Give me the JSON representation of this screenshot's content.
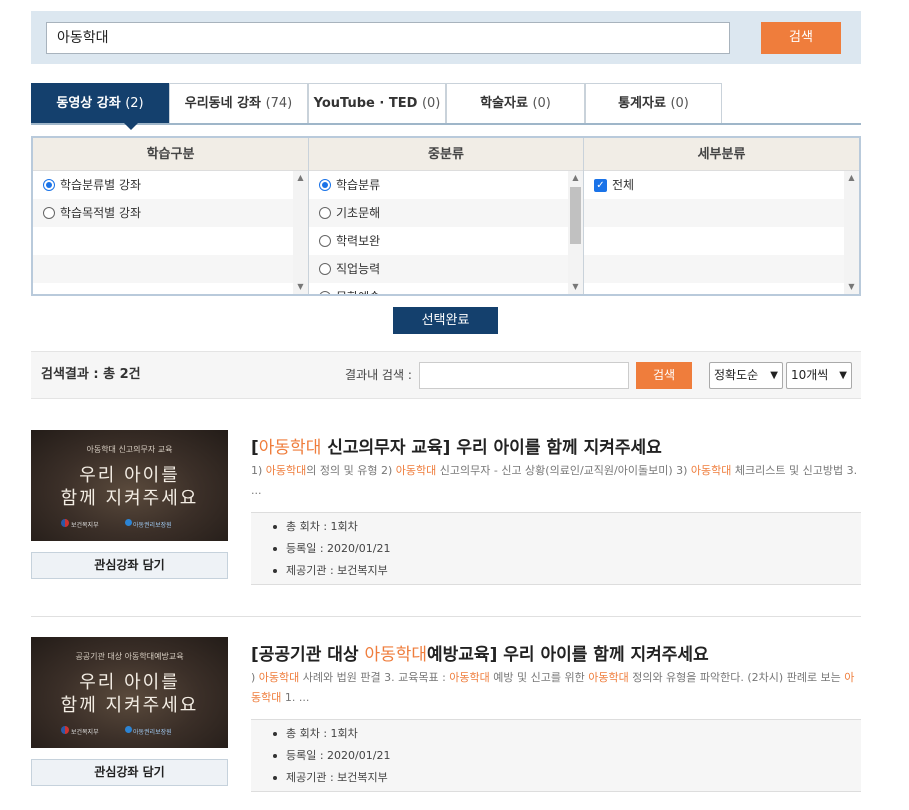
{
  "search": {
    "value": "아동학대",
    "button": "검색"
  },
  "tabs": [
    {
      "label": "동영상 강좌",
      "count": "(2)",
      "active": true
    },
    {
      "label": "우리동네 강좌",
      "count": "(74)"
    },
    {
      "label": "YouTube · TED",
      "count": "(0)"
    },
    {
      "label": "학술자료",
      "count": "(0)"
    },
    {
      "label": "통계자료",
      "count": "(0)"
    }
  ],
  "categories": {
    "col1": {
      "header": "학습구분",
      "items": [
        "학습분류별 강좌",
        "학습목적별 강좌"
      ]
    },
    "col2": {
      "header": "중분류",
      "items": [
        "학습분류",
        "기초문해",
        "학력보완",
        "직업능력",
        "문화예술"
      ]
    },
    "col3": {
      "header": "세부분류",
      "items": [
        "전체"
      ]
    }
  },
  "select_done": "선택완료",
  "result_bar": {
    "count_text": "검색결과 : 총 2건",
    "in_search_label": "결과내 검색 :",
    "in_search_button": "검색",
    "sort_value": "정확도순",
    "per_page_value": "10개씩"
  },
  "items": [
    {
      "thumb_small": "아동학대 신고의무자 교육",
      "thumb_line1": "우리 아이를",
      "thumb_line2": "함께 지켜주세요",
      "thumb_logo1": "보건복지부",
      "thumb_logo2": "아동권리보장원",
      "title_pre": "[",
      "title_hl": "아동학대",
      "title_post": " 신고의무자 교육] 우리 아이를 함께 지켜주세요",
      "desc_parts": [
        "1) ",
        "아동학대",
        "의 정의 및 유형 2) ",
        "아동학대",
        " 신고의무자 - 신고 상황(의료인/교직원/아이돌보미) 3) ",
        "아동학대",
        " 체크리스트 및 신고방법 3. ..."
      ],
      "meta": [
        "총 회차 : 1회차",
        "등록일 : 2020/01/21",
        "제공기관 : 보건복지부"
      ],
      "wish": "관심강좌 담기"
    },
    {
      "thumb_small": "공공기관 대상 아동학대예방교육",
      "thumb_line1": "우리 아이를",
      "thumb_line2": "함께 지켜주세요",
      "thumb_logo1": "보건복지부",
      "thumb_logo2": "아동권리보장원",
      "title_pre": "[공공기관 대상 ",
      "title_hl": "아동학대",
      "title_post": "예방교육] 우리 아이를 함께 지켜주세요",
      "desc_parts": [
        ") ",
        "아동학대",
        " 사례와 법원 판결 3. 교육목표 : ",
        "아동학대",
        " 예방 및 신고를 위한 ",
        "아동학대",
        " 정의와 유형을 파악한다. (2차시) 판례로 보는 ",
        "아동학대",
        " 1. ..."
      ],
      "meta": [
        "총 회차 : 1회차",
        "등록일 : 2020/01/21",
        "제공기관 : 보건복지부"
      ],
      "wish": "관심강좌 담기"
    }
  ]
}
